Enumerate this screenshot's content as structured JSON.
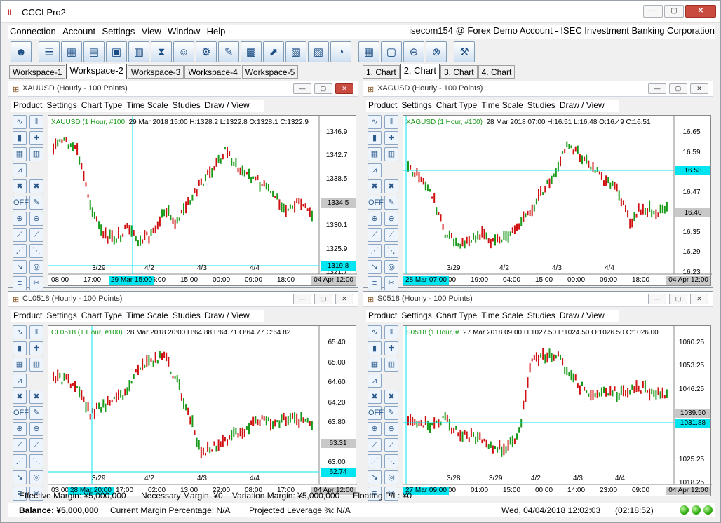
{
  "window": {
    "title": "CCCLPro2",
    "min": "—",
    "max": "▢",
    "close": "✕"
  },
  "menu": {
    "items": [
      "Connection",
      "Account",
      "Settings",
      "View",
      "Window",
      "Help"
    ],
    "account": "isecom154 @ Forex Demo Account - ISEC Investment Banking Corporation"
  },
  "toolbar": {
    "icons": [
      "logo-icon",
      "list-icon",
      "quotes-icon",
      "book-icon",
      "calendar-icon",
      "docs-icon",
      "hourglass-icon",
      "user-icon",
      "settings-icon",
      "pen-icon",
      "calc-icon",
      "chart-icon",
      "report-icon",
      "clipboard-icon",
      "signal-icon",
      "layout-icon",
      "window-icon",
      "minimize-window-icon",
      "close-window-icon",
      "tools-icon"
    ]
  },
  "workspaces": [
    "Workspace-1",
    "Workspace-2",
    "Workspace-3",
    "Workspace-4",
    "Workspace-5"
  ],
  "chart_tabs": [
    "1. Chart",
    "2. Chart",
    "3. Chart",
    "4. Chart"
  ],
  "panel_menu": [
    "Product",
    "Settings",
    "Chart Type",
    "Time Scale",
    "Studies",
    "Draw / View"
  ],
  "panels": [
    {
      "title": "XAUUSD (Hourly - 100 Points)",
      "symbol": "XAUUSD (1 Hour, #100",
      "info": "29 Mar 2018 15:00 H:1328.2 L:1322.8 O:1328.1 C:1322.9",
      "yticks": [
        "1346.9",
        "1342.7",
        "1338.5",
        "1334.5",
        "1330.1",
        "1325.9",
        "1321.7"
      ],
      "last": "1334.5",
      "cross": "1319.8",
      "date_ticks": [
        "3/29",
        "4/2",
        "4/3",
        "4/4"
      ],
      "time_ticks": [
        "08:00",
        "17:00",
        "02:",
        "05:00",
        "15:00",
        "00:00",
        "09:00",
        "18:00"
      ],
      "cursor_time": "29 Mar 15:00",
      "right_time": "04 Apr 12:00"
    },
    {
      "title": "XAGUSD (Hourly - 100 Points)",
      "symbol": "XAGUSD (1 Hour, #100)",
      "info": "28 Mar 2018 07:00 H:16.51 L:16.48 O:16.49 C:16.51",
      "yticks": [
        "16.65",
        "16.59",
        "16.53",
        "16.47",
        "16.40",
        "16.35",
        "16.29",
        "16.23"
      ],
      "last": "16.40",
      "cross": "16.53",
      "date_ticks": [
        "3/29",
        "4/2",
        "4/3",
        "4/4"
      ],
      "time_ticks": [
        "01:00",
        "10:00",
        "19:00",
        "04:00",
        "15:00",
        "00:00",
        "09:00",
        "18:00"
      ],
      "cursor_time": "28 Mar 07:00",
      "right_time": "04 Apr 12:00"
    },
    {
      "title": "CL0518 (Hourly - 100 Points)",
      "symbol": "CL0518 (1 Hour, #100)",
      "info": "28 Mar 2018 20:00 H:64.88 L:64.71 O:64.77 C:64.82",
      "yticks": [
        "65.40",
        "65.00",
        "64.60",
        "64.20",
        "63.80",
        "63.31",
        "63.00",
        "62.74"
      ],
      "last": "63.31",
      "cross": "62.74",
      "date_ticks": [
        "3/29",
        "4/2",
        "4/3",
        "4/4"
      ],
      "time_ticks": [
        "03:00",
        "08:00",
        "17:00",
        "02:00",
        "13:00",
        "22:00",
        "08:00",
        "17:00"
      ],
      "cursor_time": "28 Mar 20:00",
      "right_time": "04 Apr 12:00"
    },
    {
      "title": "S0518 (Hourly - 100 Points)",
      "symbol": "S0518 (1 Hour, #",
      "info": "27 Mar 2018 09:00 H:1027.50 L:1024.50 O:1026.50 C:1026.00",
      "yticks": [
        "1060.25",
        "1053.25",
        "1046.25",
        "1039.50",
        "1031.88",
        "1025.25",
        "1018.25"
      ],
      "last": "1039.50",
      "cross": "1031.88",
      "date_ticks": [
        "3/28",
        "3/29",
        "4/2",
        "4/3",
        "4/4"
      ],
      "time_ticks": [
        "02:00",
        "16:00",
        "01:00",
        "15:00",
        "00:00",
        "14:00",
        "23:00",
        "09:00"
      ],
      "cursor_time": "27 Mar 09:00",
      "right_time": "04 Apr 12:00"
    }
  ],
  "status": {
    "effective_margin": "Effective Margin: ¥5,000,000",
    "necessary_margin": "Necessary Margin: ¥0",
    "variation_margin": "Variation Margin: ¥5,000,000",
    "floating_pl": "Floating P/L: ¥0",
    "balance": "Balance: ¥5,000,000",
    "margin_pct": "Current Margin Percentage: N/A",
    "leverage": "Projected Leverage %: N/A",
    "datetime": "Wed, 04/04/2018 12:02:03",
    "elapsed": "(02:18:52)"
  },
  "colors": {
    "up": "#1a9a1a",
    "down": "#d01010",
    "cross": "#00e5f0",
    "gray": "#c8c8c8"
  }
}
